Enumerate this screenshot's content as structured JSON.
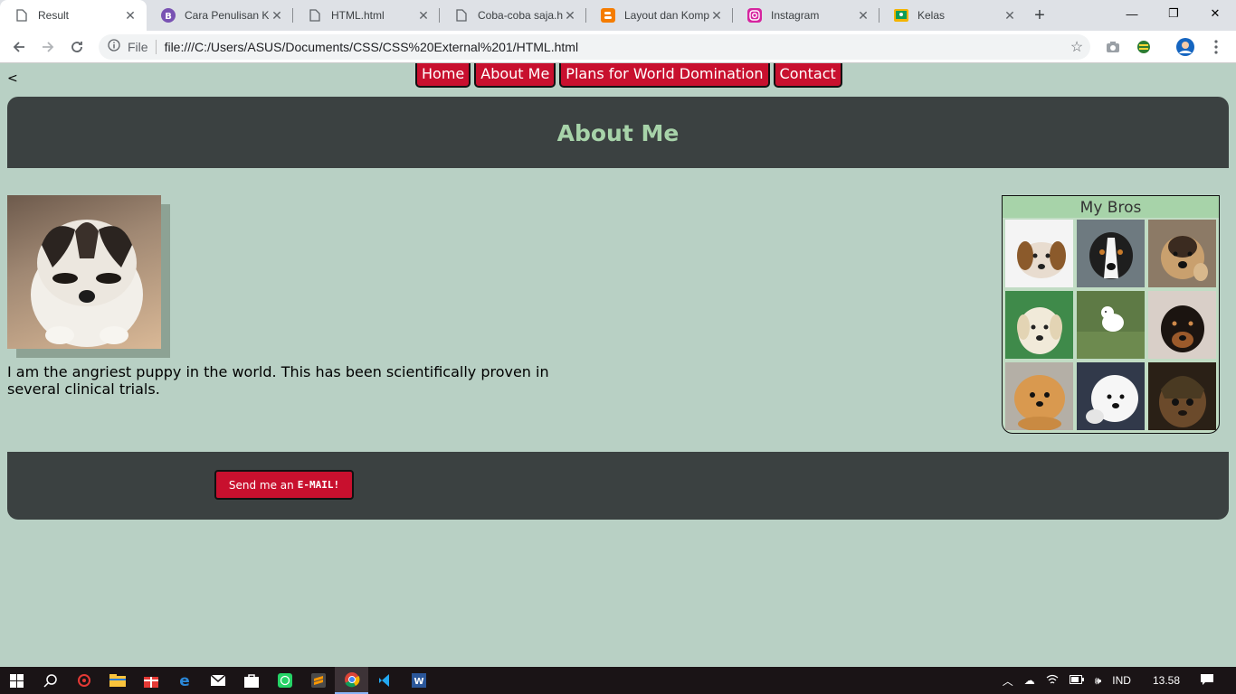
{
  "browser": {
    "tabs": [
      {
        "label": "Result",
        "icon": "page-icon",
        "active": true
      },
      {
        "label": "Cara Penulisan Ko",
        "icon": "bootstrap-icon",
        "active": false
      },
      {
        "label": "HTML.html",
        "icon": "page-icon",
        "active": false
      },
      {
        "label": "Coba-coba saja.ht",
        "icon": "page-icon",
        "active": false
      },
      {
        "label": "Layout dan Kompo",
        "icon": "blogger-icon",
        "active": false
      },
      {
        "label": "Instagram",
        "icon": "instagram-icon",
        "active": false
      },
      {
        "label": "Kelas",
        "icon": "classroom-icon",
        "active": false
      }
    ],
    "new_tab": "+",
    "window_controls": {
      "minimize": "—",
      "restore": "❐",
      "close": "✕"
    },
    "omnibox": {
      "scheme_label": "File",
      "url": "file:///C:/Users/ASUS/Documents/CSS/CSS%20External%201/HTML.html"
    }
  },
  "page": {
    "back_link": "< ",
    "nav": [
      "Home",
      "About Me",
      "Plans for World Domination",
      "Contact"
    ],
    "header_title": "About Me",
    "bio": "I am the angriest puppy in the world. This has been scientifically proven in several clinical trials.",
    "bros_title": "My Bros",
    "email_prefix": "Send me an",
    "email_bold": "E-MAIL!",
    "colors": {
      "accent": "#c8102e",
      "panel": "#3b4141",
      "background": "#b8d0c4",
      "title": "#a7d3a9"
    }
  },
  "taskbar": {
    "language": "IND",
    "time": "13.58"
  }
}
